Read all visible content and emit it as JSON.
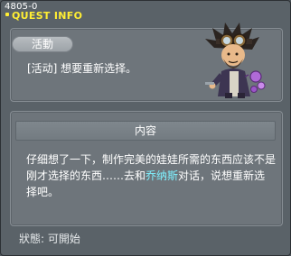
{
  "window": {
    "id_label": "4805-0",
    "title": "QUEST INFO"
  },
  "quest": {
    "category_badge": "活動",
    "name": "[活动] 想要重新选择。"
  },
  "npc_portrait": {
    "icon": "goggles-scientist-npc-icon"
  },
  "content": {
    "header": "内容",
    "text_part1": "仔细想了一下，制作完美的娃娃所需的东西应该不是刚才选择的东西……去和",
    "npc_name": "乔纳斯",
    "text_part2": "对话，说想重新选择吧。"
  },
  "status": {
    "text": "狀態: 可開始"
  },
  "colors": {
    "title": "#ffee33",
    "npc_highlight": "#7ff1ff",
    "panel": "#6e757b",
    "window": "#5a6268"
  }
}
